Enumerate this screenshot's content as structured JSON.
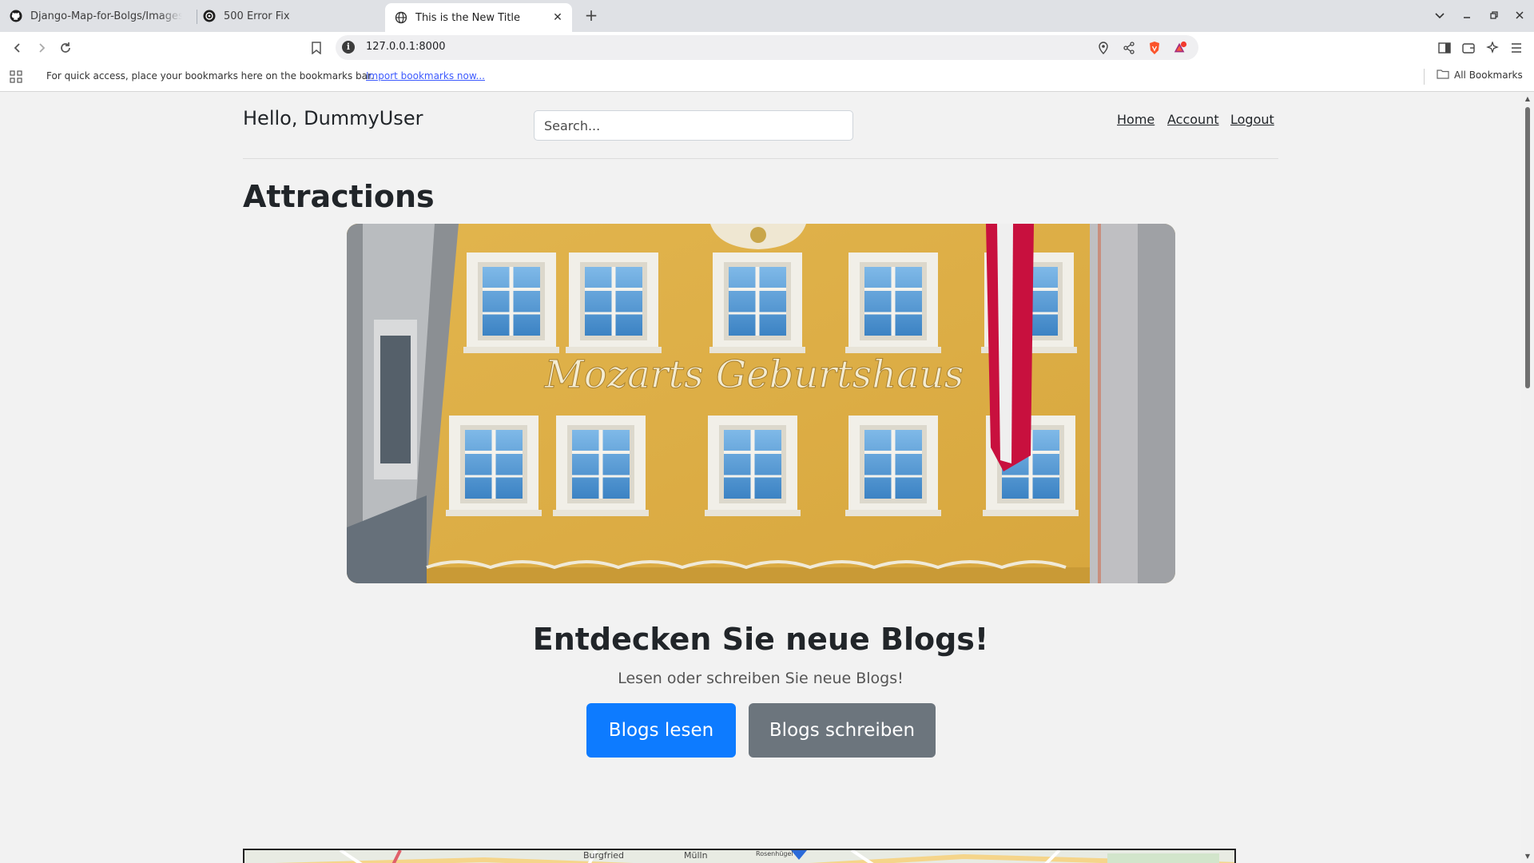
{
  "browser": {
    "tabs": [
      {
        "title": "Django-Map-for-Bolgs/Images a",
        "icon": "github-icon"
      },
      {
        "title": "500 Error Fix",
        "icon": "openai-icon"
      },
      {
        "title": "This is the New Title",
        "icon": "globe-icon",
        "active": true
      }
    ],
    "address": "127.0.0.1:8000",
    "bookmarks_bar": {
      "message": "For quick access, place your bookmarks here on the bookmarks bar.",
      "import_link": "Import bookmarks now...",
      "all_bookmarks": "All Bookmarks"
    },
    "brave_badge_color": "#fb542b"
  },
  "header": {
    "greeting": "Hello, DummyUser",
    "search_placeholder": "Search...",
    "nav": [
      "Home",
      "Account",
      "Logout"
    ]
  },
  "main": {
    "title": "Attractions",
    "hero_sign": "Mozarts Geburtshaus",
    "cta_title": "Entdecken Sie neue Blogs!",
    "cta_subtitle": "Lesen oder schreiben Sie neue Blogs!",
    "primary_button": "Blogs lesen",
    "secondary_button": "Blogs schreiben",
    "primary_color": "#0d7bff",
    "secondary_color": "#6c757d"
  },
  "map": {
    "labels": [
      "Burgfried",
      "Mülln",
      "Rosenhügel"
    ]
  }
}
